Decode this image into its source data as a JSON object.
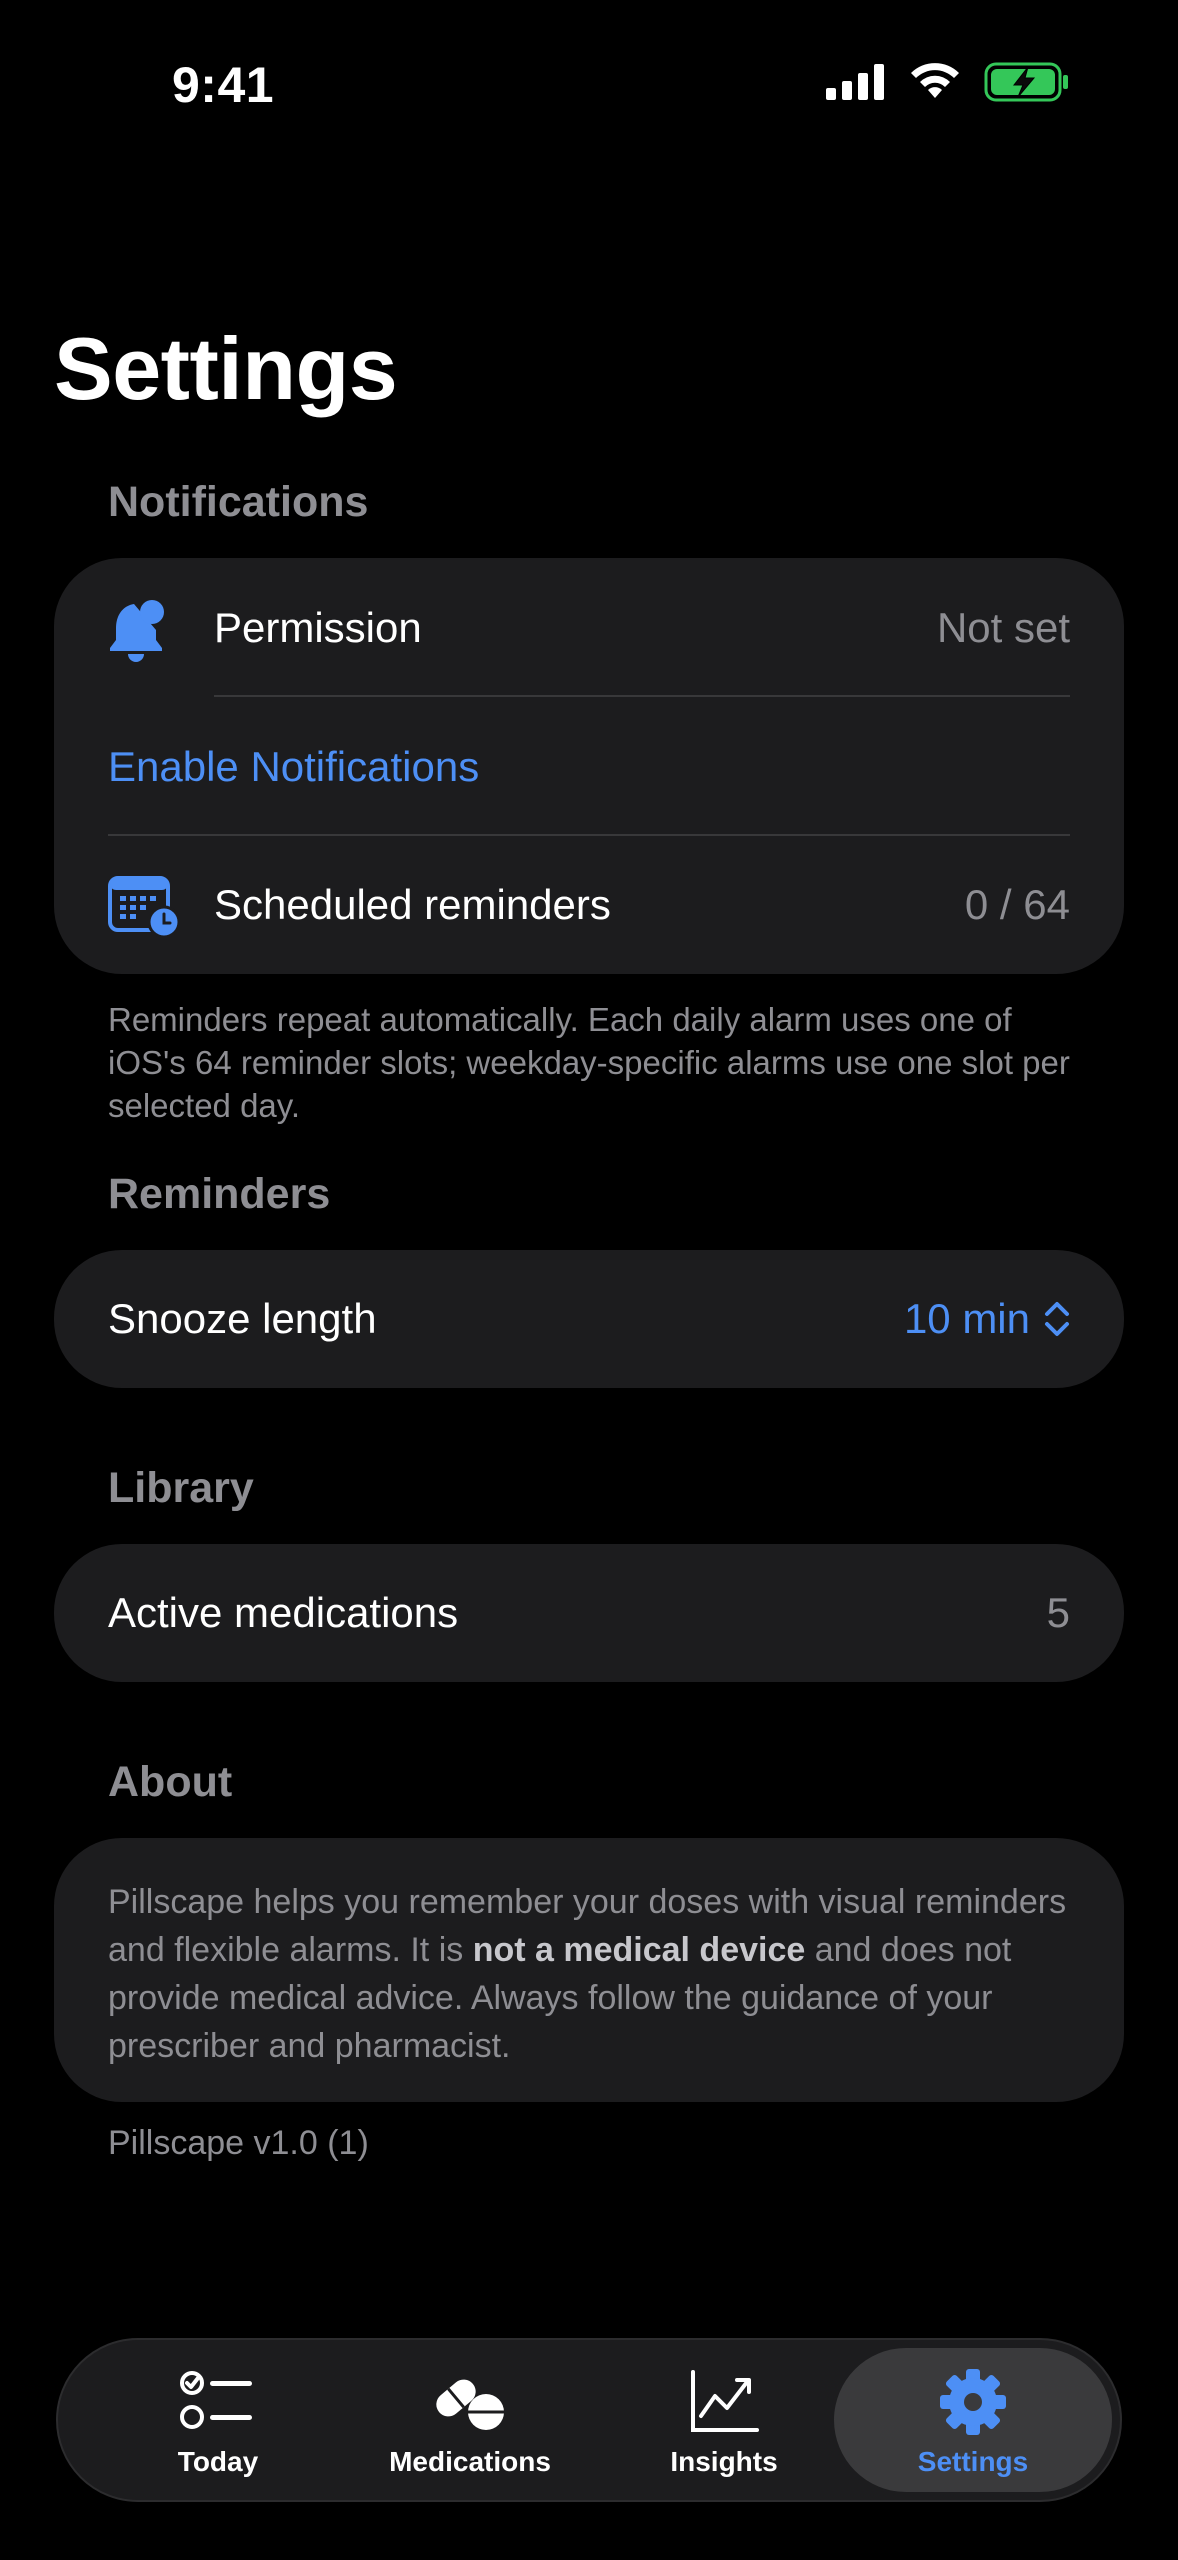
{
  "status_bar": {
    "time": "9:41"
  },
  "page": {
    "title": "Settings"
  },
  "sections": {
    "notifications": {
      "header": "Notifications",
      "permission_label": "Permission",
      "permission_value": "Not set",
      "enable_link": "Enable Notifications",
      "scheduled_label": "Scheduled reminders",
      "scheduled_value": "0 / 64",
      "footnote": "Reminders repeat automatically. Each daily alarm uses one of iOS's 64 reminder slots; weekday-specific alarms use one slot per selected day."
    },
    "reminders": {
      "header": "Reminders",
      "snooze_label": "Snooze length",
      "snooze_value": "10 min"
    },
    "library": {
      "header": "Library",
      "active_label": "Active medications",
      "active_value": "5"
    },
    "about": {
      "header": "About",
      "text_before": "Pillscape helps you remember your doses with visual reminders and flexible alarms. It is ",
      "text_bold": "not a medical device",
      "text_after": " and does not provide medical advice. Always follow the guidance of your prescriber and pharmacist.",
      "version": "Pillscape v1.0 (1)"
    }
  },
  "tab_bar": {
    "tabs": [
      {
        "label": "Today",
        "icon": "checklist-icon"
      },
      {
        "label": "Medications",
        "icon": "pills-icon"
      },
      {
        "label": "Insights",
        "icon": "chart-line-icon"
      },
      {
        "label": "Settings",
        "icon": "gear-icon"
      }
    ],
    "active": "Settings"
  },
  "colors": {
    "accent": "#4d8ff5",
    "background": "#000000",
    "card": "#1c1c1e",
    "secondary_text": "#8e8e93",
    "battery": "#34c759"
  }
}
